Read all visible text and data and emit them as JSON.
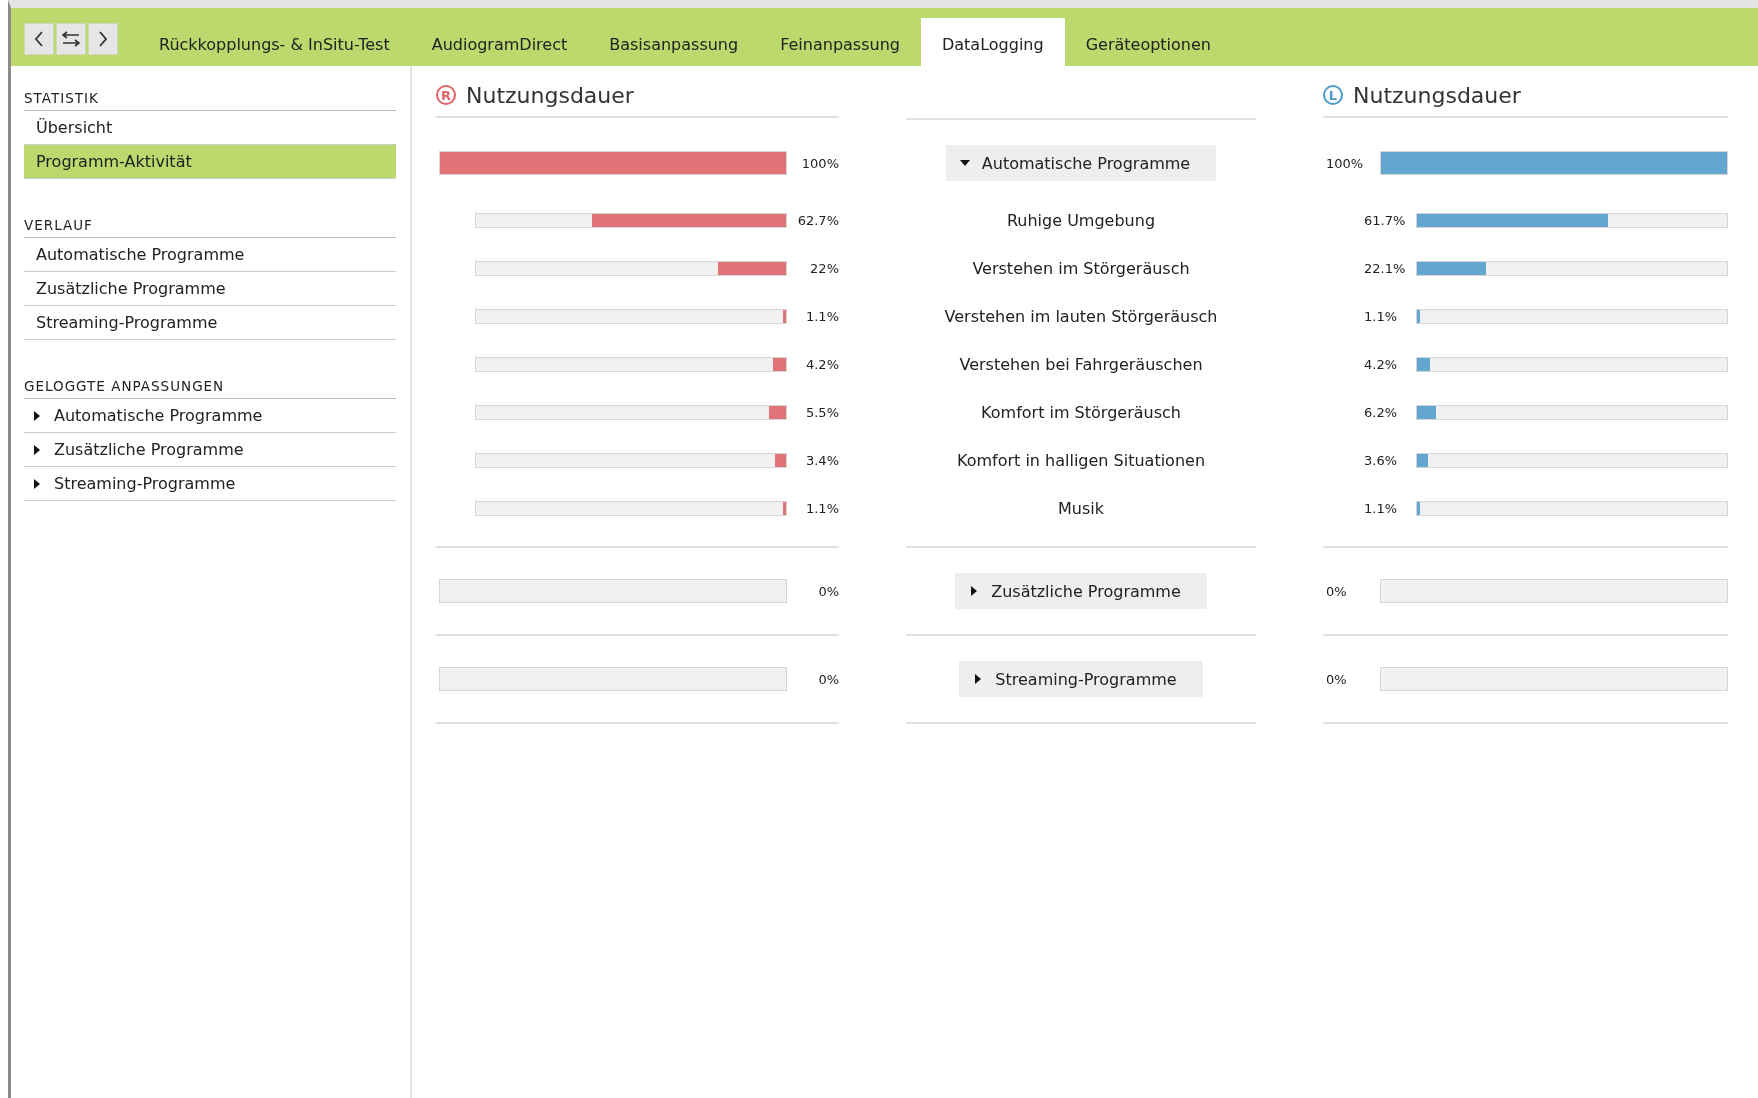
{
  "tabs": [
    {
      "label": "Rückkopplungs- & InSitu-Test",
      "selected": false
    },
    {
      "label": "AudiogramDirect",
      "selected": false
    },
    {
      "label": "Basisanpassung",
      "selected": false
    },
    {
      "label": "Feinanpassung",
      "selected": false
    },
    {
      "label": "DataLogging",
      "selected": true
    },
    {
      "label": "Geräteoptionen",
      "selected": false
    }
  ],
  "sidebar": {
    "sections": [
      {
        "title": "STATISTIK",
        "items": [
          {
            "label": "Übersicht",
            "selected": false,
            "kind": "link"
          },
          {
            "label": "Programm-Aktivität",
            "selected": true,
            "kind": "link"
          }
        ]
      },
      {
        "title": "VERLAUF",
        "items": [
          {
            "label": "Automatische Programme",
            "selected": false,
            "kind": "link"
          },
          {
            "label": "Zusätzliche Programme",
            "selected": false,
            "kind": "link"
          },
          {
            "label": "Streaming-Programme",
            "selected": false,
            "kind": "link"
          }
        ]
      },
      {
        "title": "GELOGGTE ANPASSUNGEN",
        "items": [
          {
            "label": "Automatische Programme",
            "selected": false,
            "kind": "expander",
            "expanded": false
          },
          {
            "label": "Zusätzliche Programme",
            "selected": false,
            "kind": "expander",
            "expanded": false
          },
          {
            "label": "Streaming-Programme",
            "selected": false,
            "kind": "expander",
            "expanded": false
          }
        ]
      }
    ]
  },
  "right_ear": {
    "letter": "R",
    "title": "Nutzungsdauer"
  },
  "left_ear": {
    "letter": "L",
    "title": "Nutzungsdauer"
  },
  "groups": [
    {
      "label": "Automatische Programme",
      "expanded": true,
      "right": {
        "level": 1,
        "reading": "100%"
      },
      "left": {
        "level": 1,
        "reading": "100%"
      },
      "programs": [
        {
          "name": "Ruhige Umgebung",
          "right": {
            "level": 0.627,
            "reading": "62.7%"
          },
          "left": {
            "level": 0.617,
            "reading": "61.7%"
          }
        },
        {
          "name": "Verstehen im Störgeräusch",
          "right": {
            "level": 0.22,
            "reading": "22%"
          },
          "left": {
            "level": 0.221,
            "reading": "22.1%"
          }
        },
        {
          "name": "Verstehen im lauten Störgeräusch",
          "right": {
            "level": 0.011,
            "reading": "1.1%"
          },
          "left": {
            "level": 0.011,
            "reading": "1.1%"
          }
        },
        {
          "name": "Verstehen bei Fahrgeräuschen",
          "right": {
            "level": 0.042,
            "reading": "4.2%"
          },
          "left": {
            "level": 0.042,
            "reading": "4.2%"
          }
        },
        {
          "name": "Komfort im Störgeräusch",
          "right": {
            "level": 0.055,
            "reading": "5.5%"
          },
          "left": {
            "level": 0.062,
            "reading": "6.2%"
          }
        },
        {
          "name": "Komfort in halligen Situationen",
          "right": {
            "level": 0.034,
            "reading": "3.4%"
          },
          "left": {
            "level": 0.036,
            "reading": "3.6%"
          }
        },
        {
          "name": "Musik",
          "right": {
            "level": 0.011,
            "reading": "1.1%"
          },
          "left": {
            "level": 0.011,
            "reading": "1.1%"
          }
        }
      ]
    },
    {
      "label": "Zusätzliche Programme",
      "expanded": false,
      "right": {
        "level": 0,
        "reading": "0%"
      },
      "left": {
        "level": 0,
        "reading": "0%"
      }
    },
    {
      "label": "Streaming-Programme",
      "expanded": false,
      "right": {
        "level": 0,
        "reading": "0%"
      },
      "left": {
        "level": 0,
        "reading": "0%"
      }
    }
  ]
}
